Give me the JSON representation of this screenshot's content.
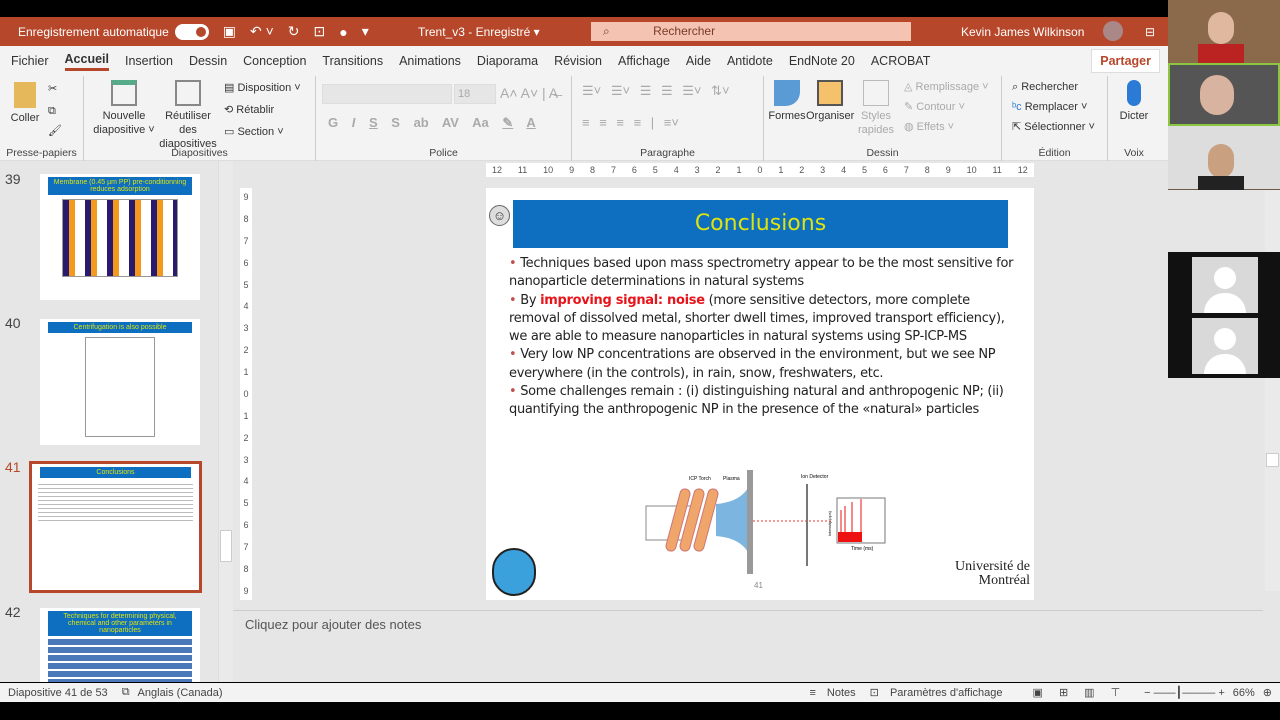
{
  "titlebar": {
    "autosave": "Enregistrement automatique",
    "doc": "Trent_v3  -  Enregistré ▾",
    "search": "Rechercher",
    "user": "Kevin James Wilkinson"
  },
  "tabs": [
    "Fichier",
    "Accueil",
    "Insertion",
    "Dessin",
    "Conception",
    "Transitions",
    "Animations",
    "Diaporama",
    "Révision",
    "Affichage",
    "Aide",
    "Antidote",
    "EndNote 20",
    "ACROBAT"
  ],
  "share": "Partager",
  "ribbon": {
    "clipboard": {
      "paste": "Coller",
      "label": "Presse-papiers"
    },
    "slides": {
      "new": "Nouvelle diapositive ˅",
      "reuse": "Réutiliser des diapositives",
      "layout": "Disposition ˅",
      "reset": "Rétablir",
      "section": "Section ˅",
      "label": "Diapositives"
    },
    "font": {
      "size": "18",
      "label": "Police",
      "buttons": [
        "G",
        "I",
        "S",
        "S"
      ]
    },
    "paragraph": {
      "label": "Paragraphe"
    },
    "drawing": {
      "shapes": "Formes",
      "arrange": "Organiser",
      "styles": "Styles rapides",
      "fill": "Remplissage ˅",
      "outline": "Contour ˅",
      "effects": "Effets ˅",
      "label": "Dessin"
    },
    "editing": {
      "find": "Rechercher",
      "replace": "Remplacer ˅",
      "select": "Sélectionner ˅",
      "label": "Édition"
    },
    "voice": {
      "dictate": "Dicter",
      "label": "Voix"
    }
  },
  "thumbnails": [
    {
      "num": "39",
      "title": "Membrane (0.45 µm PP) pre-conditionning reduces adsorption"
    },
    {
      "num": "40",
      "title": "Centrifugation is also possible"
    },
    {
      "num": "41",
      "title": "Conclusions",
      "selected": true
    },
    {
      "num": "42",
      "title": "Techniques for determining physical, chemical and other parameters in nanoparticles"
    }
  ],
  "ruler": [
    "12",
    "11",
    "10",
    "9",
    "8",
    "7",
    "6",
    "5",
    "4",
    "3",
    "2",
    "1",
    "0",
    "1",
    "2",
    "3",
    "4",
    "5",
    "6",
    "7",
    "8",
    "9",
    "10",
    "11",
    "12"
  ],
  "vruler": [
    "9",
    "8",
    "7",
    "6",
    "5",
    "4",
    "3",
    "2",
    "1",
    "0",
    "1",
    "2",
    "3",
    "4",
    "5",
    "6",
    "7",
    "8",
    "9"
  ],
  "slide": {
    "title": "Conclusions",
    "b1": "Techniques based upon mass spectrometry appear to be the most sensitive for nanoparticle determinations in natural systems",
    "b2_pre": "By ",
    "b2_red": "improving signal: noise",
    "b2_post": " (more sensitive detectors, more complete removal of dissolved metal, shorter dwell times, improved transport efficiency), we are able to measure nanoparticles in natural systems using SP-ICP-MS",
    "b3": "Very low NP concentrations are observed in the environment, but we see NP everywhere (in the controls), in rain, snow, freshwaters, etc.",
    "b4": "Some challenges remain : (i) distinguishing natural and anthropogenic NP; (ii) quantifying the anthropogenic NP in the presence of the «natural» particles",
    "diagram": {
      "torch": "ICP Torch",
      "plasma": "Plasma",
      "detector": "Ion Detector",
      "xaxis": "Time (ms)",
      "yaxis": "Intensity (cps)"
    },
    "page": "41",
    "logo": "Université de Montréal",
    "colors": {
      "title_bg": "#0e6ebf",
      "title_fg": "#dde40d",
      "highlight": "#e8141b"
    }
  },
  "notes": "Cliquez pour ajouter des notes",
  "status": {
    "slide": "Diapositive 41 de 53",
    "lang": "Anglais (Canada)",
    "notes": "Notes",
    "view": "Paramètres d'affichage",
    "zoom": "66%"
  },
  "accent": "#b7472a"
}
